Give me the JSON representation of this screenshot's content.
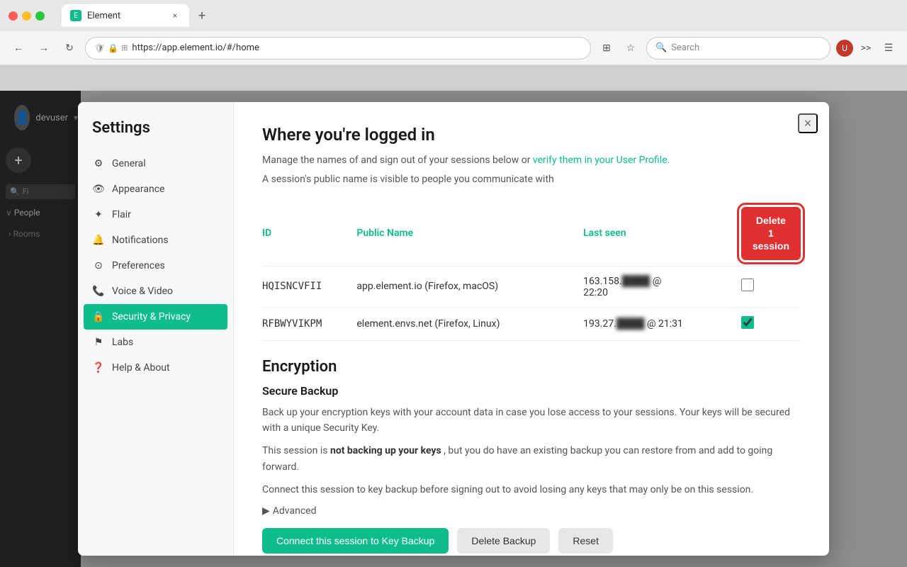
{
  "browser": {
    "tab_title": "Element",
    "tab_new_label": "+",
    "address_url": "https://app.element.io/#/home",
    "search_placeholder": "Search",
    "back_icon": "←",
    "forward_icon": "→",
    "refresh_icon": "↻"
  },
  "sidebar": {
    "user": "devuser",
    "search_placeholder": "Fi",
    "people_label": "People",
    "rooms_label": "Rooms"
  },
  "settings": {
    "title": "Settings",
    "close_icon": "×",
    "nav_items": [
      {
        "id": "general",
        "icon": "⚙",
        "label": "General",
        "active": false
      },
      {
        "id": "appearance",
        "icon": "👁",
        "label": "Appearance",
        "active": false
      },
      {
        "id": "flair",
        "icon": "✦",
        "label": "Flair",
        "active": false
      },
      {
        "id": "notifications",
        "icon": "🔔",
        "label": "Notifications",
        "active": false
      },
      {
        "id": "preferences",
        "icon": "⊙",
        "label": "Preferences",
        "active": false
      },
      {
        "id": "voice",
        "icon": "📞",
        "label": "Voice & Video",
        "active": false
      },
      {
        "id": "security",
        "icon": "🔒",
        "label": "Security & Privacy",
        "active": true
      },
      {
        "id": "labs",
        "icon": "⚑",
        "label": "Labs",
        "active": false
      },
      {
        "id": "help",
        "icon": "❓",
        "label": "Help & About",
        "active": false
      }
    ],
    "content": {
      "sessions_section": {
        "title": "Where you're logged in",
        "description_part1": "Manage the names of and sign out of your sessions below or ",
        "link_text": "verify them in your User Profile.",
        "description_part2": "A session's public name is visible to people you communicate with",
        "table_headers": {
          "id": "ID",
          "public_name": "Public Name",
          "last_seen": "Last seen"
        },
        "sessions": [
          {
            "id": "HQISNCVFII",
            "public_name": "app.element.io (Firefox, macOS)",
            "last_seen": "163.158.███ @",
            "last_seen_time": "22:20",
            "selected": false
          },
          {
            "id": "RFBWYVIKPM",
            "public_name": "element.envs.net (Firefox, Linux)",
            "last_seen": "193.27.███ @ 21:31",
            "selected": true
          }
        ],
        "delete_button": "Delete 1\nsession"
      },
      "encryption_section": {
        "title": "Encryption",
        "backup_title": "Secure Backup",
        "backup_desc": "Back up your encryption keys with your account data in case you lose access to your sessions. Your keys will be secured with a unique Security Key.",
        "status_text_prefix": "This session is ",
        "status_bold": "not backing up your keys",
        "status_text_suffix": ", but you do have an existing backup you can restore from and add to going forward.",
        "warning_text": "Connect this session to key backup before signing out to avoid losing any keys that may only be on this session.",
        "advanced_label": "Advanced",
        "advanced_arrow": "▶",
        "buttons": {
          "connect": "Connect this session to Key Backup",
          "delete": "Delete Backup",
          "reset": "Reset"
        }
      }
    }
  }
}
